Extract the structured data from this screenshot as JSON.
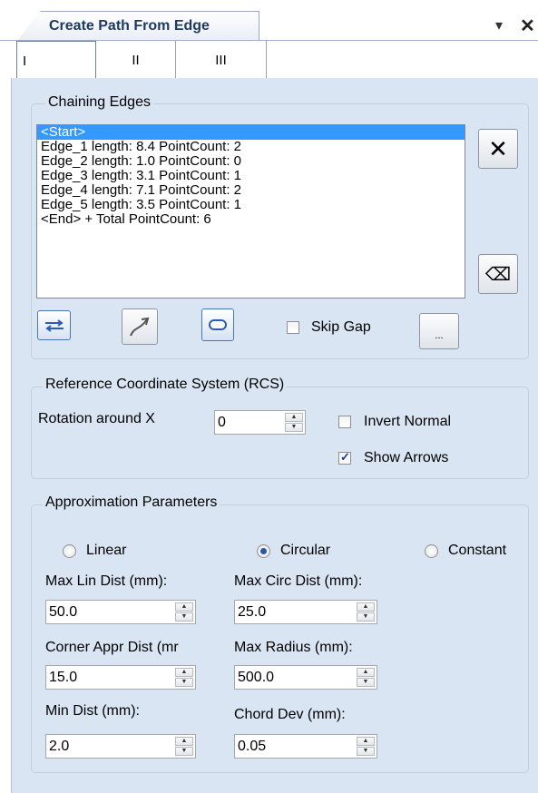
{
  "window": {
    "title": "Create Path From Edge",
    "pin_glyph": "▾",
    "close_glyph": "✕"
  },
  "tabs": [
    {
      "label": "I"
    },
    {
      "label": "II"
    },
    {
      "label": "III"
    }
  ],
  "chaining": {
    "group_label": "Chaining Edges",
    "items": [
      "<Start>",
      "Edge_1 length: 8.4 PointCount: 2",
      "Edge_2 length: 1.0 PointCount: 0",
      "Edge_3 length: 3.1 PointCount: 1",
      "Edge_4 length: 7.1 PointCount: 2",
      "Edge_5 length: 3.5 PointCount: 1",
      "<End> + Total PointCount: 6"
    ],
    "selected_index": 0,
    "remove_glyph": "✕",
    "backspace_glyph": "⌫",
    "skip_gap_label": "Skip Gap",
    "skip_gap_checked": false,
    "more_label": "..."
  },
  "rcs": {
    "group_label": "Reference Coordinate System (RCS)",
    "rotation_label": "Rotation around X",
    "rotation_value": "0",
    "invert_normal_label": "Invert Normal",
    "invert_normal_checked": false,
    "show_arrows_label": "Show Arrows",
    "show_arrows_checked": true
  },
  "approx": {
    "group_label": "Approximation Parameters",
    "modes": [
      {
        "label": "Linear",
        "checked": false
      },
      {
        "label": "Circular",
        "checked": true
      },
      {
        "label": "Constant",
        "checked": false
      }
    ],
    "max_lin_dist_label": "Max Lin Dist (mm):",
    "max_lin_dist_value": "50.0",
    "max_circ_dist_label": "Max Circ Dist (mm):",
    "max_circ_dist_value": "25.0",
    "corner_appr_label": "Corner Appr Dist (mr",
    "corner_appr_value": "15.0",
    "max_radius_label": "Max Radius (mm):",
    "max_radius_value": "500.0",
    "min_dist_label": "Min Dist (mm):",
    "min_dist_value": "2.0",
    "chord_dev_label": "Chord Dev (mm):",
    "chord_dev_value": "0.05"
  },
  "colors": {
    "panel_bg": "#d9e5f3",
    "selection": "#3399ff",
    "title_text": "#1e3a5f"
  }
}
